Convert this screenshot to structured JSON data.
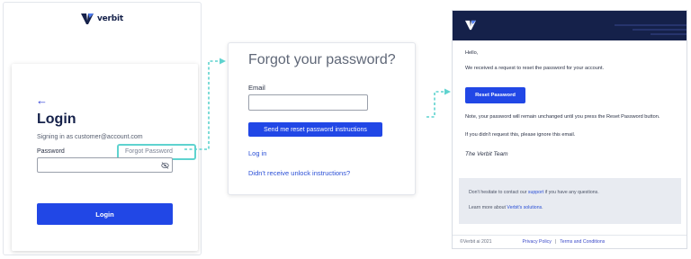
{
  "brand": {
    "name": "verbit",
    "logo_color": "#15214a",
    "accent_color": "#2147e6",
    "highlight_color": "#5fd3cf"
  },
  "login": {
    "back_icon": "arrow-left-icon",
    "title": "Login",
    "signing_in_as": "Signing in as customer@account.com",
    "password_label": "Password",
    "forgot_password_link": "Forgot Password",
    "password_value": "",
    "eye_icon": "eye-off-icon",
    "login_button": "Login"
  },
  "forgot": {
    "title": "Forgot your password?",
    "email_label": "Email",
    "email_value": "",
    "reset_button": "Send me reset password instructions",
    "login_link": "Log in",
    "unlock_link": "Didn't receive unlock instructions?"
  },
  "email": {
    "greeting": "Hello,",
    "request_line": "We received a request to reset the password for your account.",
    "reset_button": "Reset Password",
    "note_line": "Note, your password will remain unchanged until you press the Reset Password button.",
    "ignore_line": "If you didn't request this, please ignore this email.",
    "signature": "The Verbit Team",
    "footer": {
      "contact_prefix": "Don't hesitate to contact our",
      "contact_link": "support",
      "contact_suffix": "if you have any questions.",
      "learn_prefix": "Learn more about",
      "learn_link": "Verbit's solutions",
      "learn_suffix": "."
    },
    "bottom": {
      "copyright": "©Verbit ai 2021",
      "privacy": "Privacy Policy",
      "separator": "|",
      "terms": "Terms and Conditions"
    }
  }
}
